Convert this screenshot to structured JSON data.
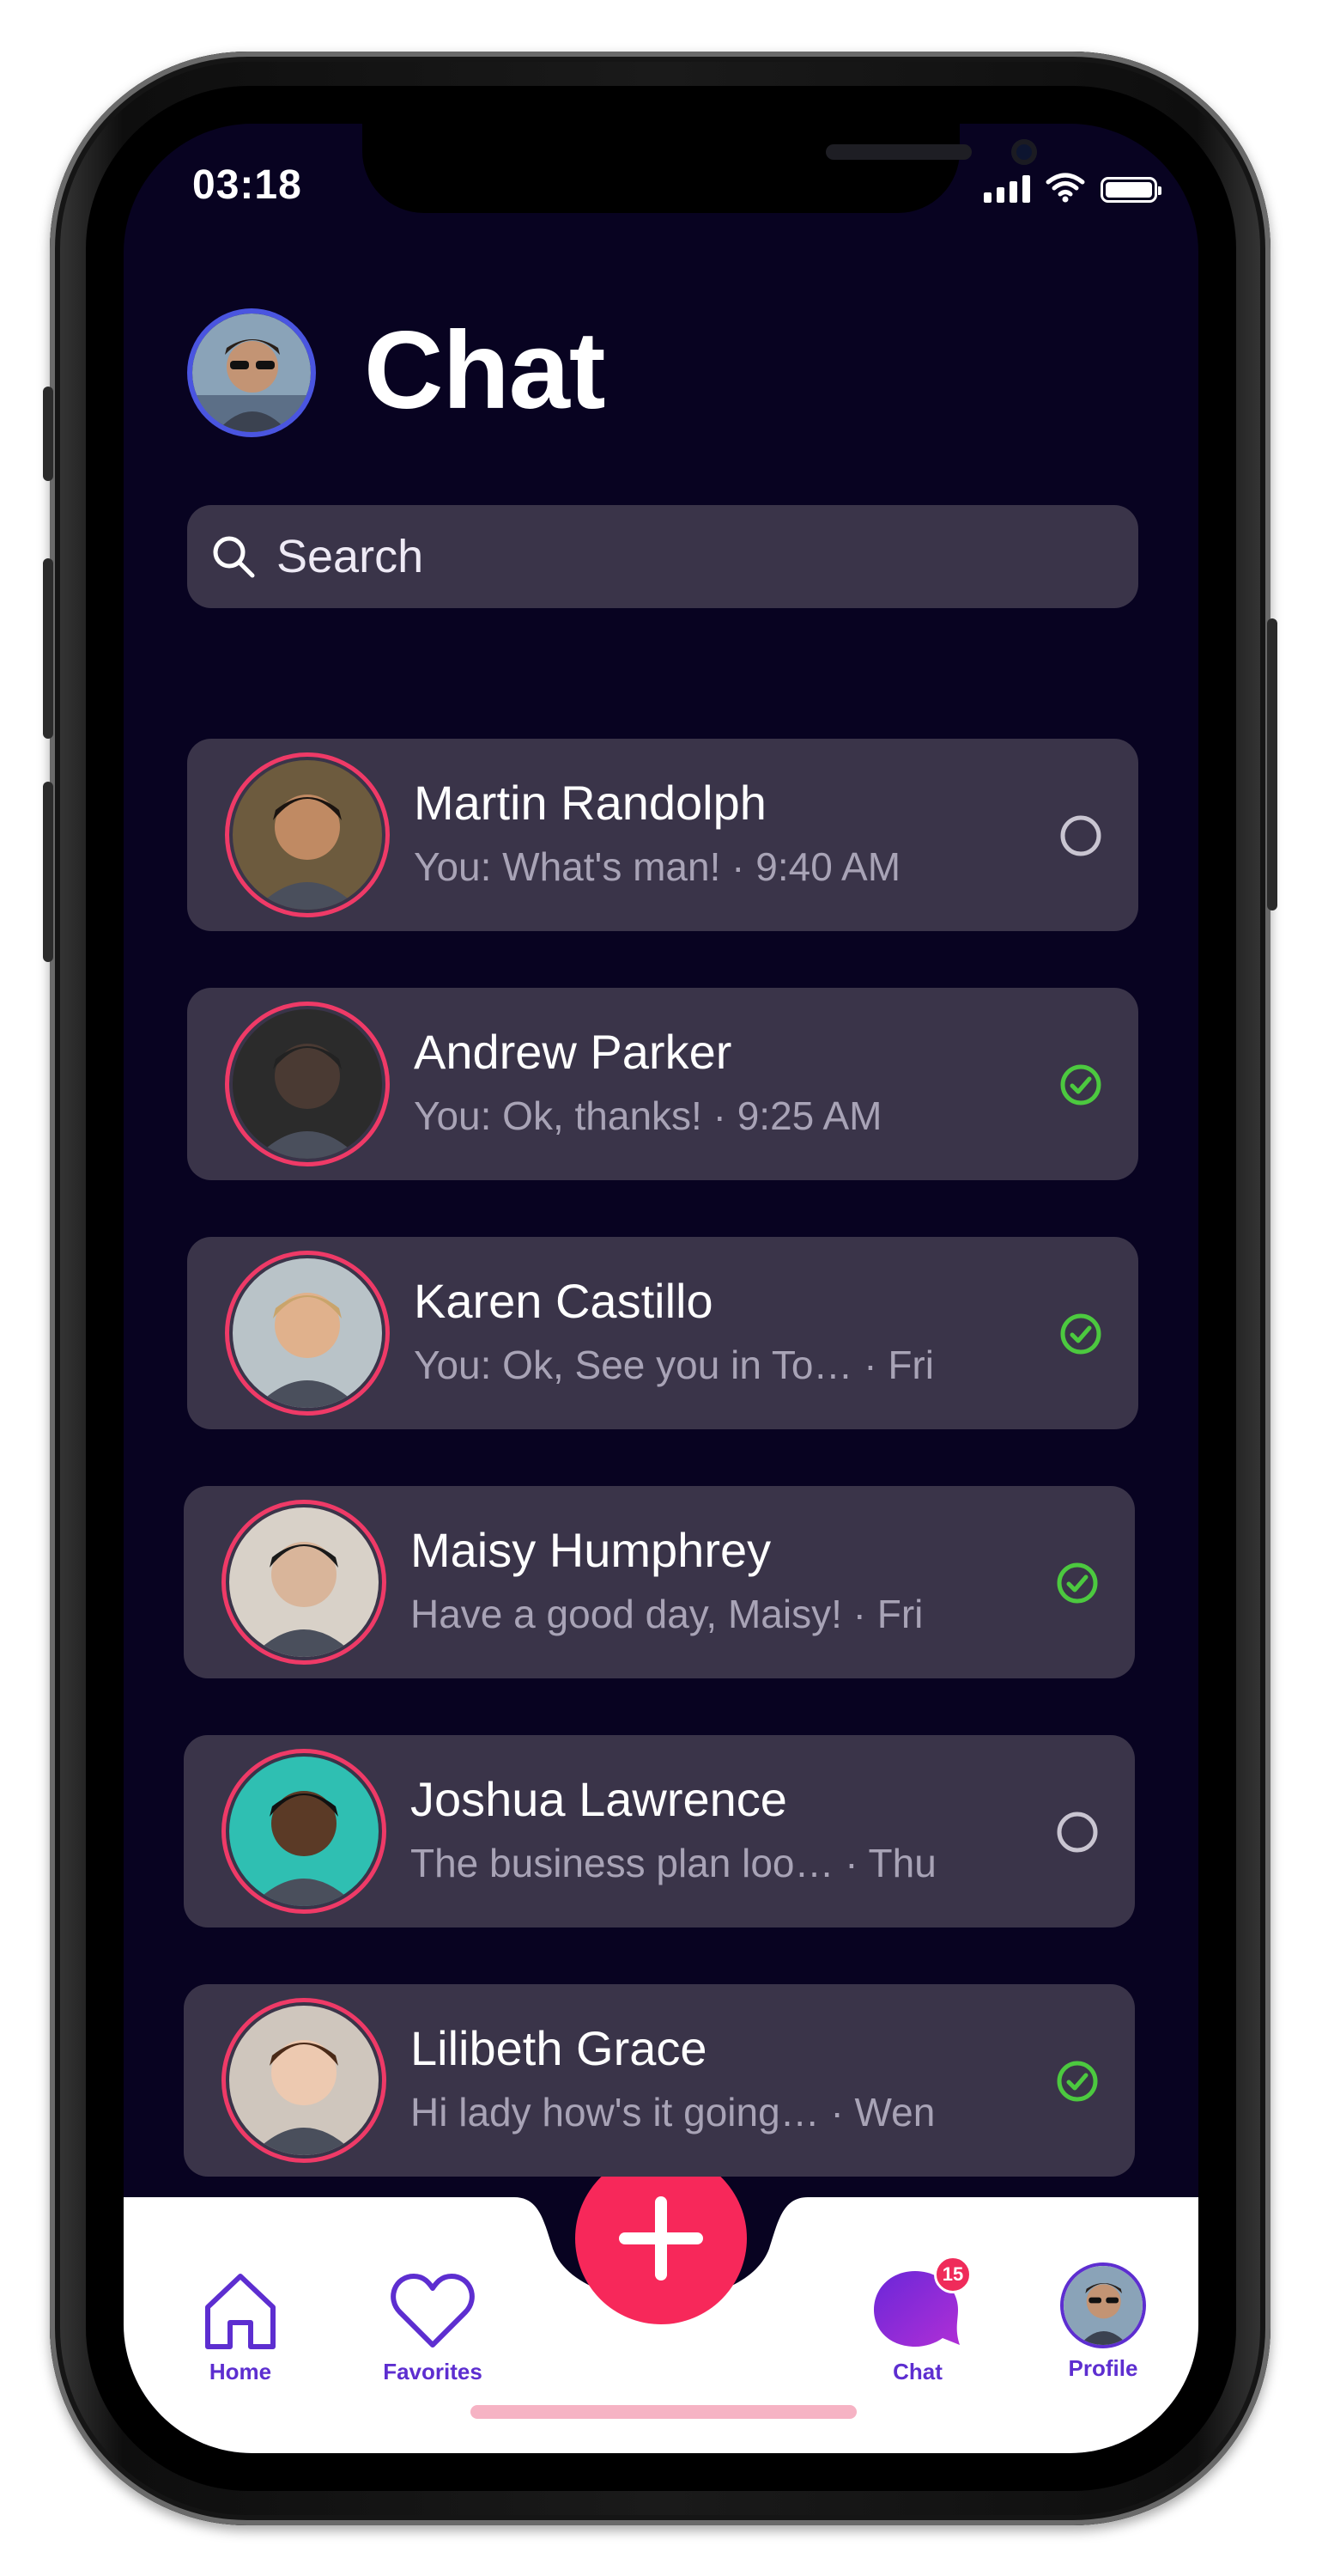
{
  "status_bar": {
    "time": "03:18"
  },
  "header": {
    "title": "Chat"
  },
  "search": {
    "placeholder": "Search"
  },
  "chats": [
    {
      "name": "Martin Randolph",
      "message": "You: What's man! · 9:40 AM",
      "status": "sent"
    },
    {
      "name": "Andrew Parker",
      "message": "You: Ok, thanks! · 9:25 AM",
      "status": "read"
    },
    {
      "name": "Karen Castillo",
      "message": "You: Ok, See you in To… · Fri",
      "status": "read"
    },
    {
      "name": "Maisy Humphrey",
      "message": "Have a good day, Maisy! · Fri",
      "status": "read"
    },
    {
      "name": "Joshua Lawrence",
      "message": "The business plan loo…  · Thu",
      "status": "sent"
    },
    {
      "name": "Lilibeth Grace",
      "message": "Hi lady how's it going…  · Wen",
      "status": "read"
    }
  ],
  "nav": {
    "home": "Home",
    "favorites": "Favorites",
    "chat": "Chat",
    "chat_badge": "15",
    "profile": "Profile"
  },
  "colors": {
    "screen_bg": "#080321",
    "card_bg": "#3a3449",
    "accent_pink": "#f7285a",
    "avatar_ring": "#ef3a67",
    "read_green": "#4cc93f",
    "nav_purple": "#5d2ed0"
  },
  "icons": [
    "search-icon",
    "plus-icon",
    "home-icon",
    "heart-icon",
    "chat-bubble-icon",
    "read-check-icon",
    "sent-circle-icon"
  ]
}
